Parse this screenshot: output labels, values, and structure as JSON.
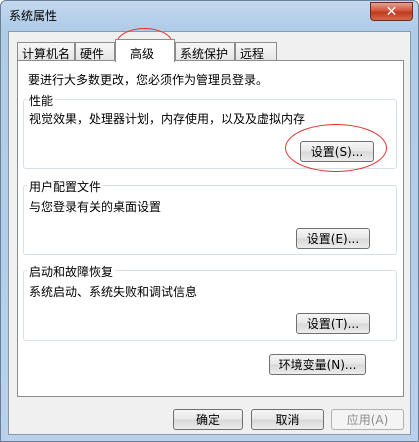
{
  "window": {
    "title": "系统属性",
    "close_symbol": "✕"
  },
  "tabs": [
    {
      "label": "计算机名",
      "active": false
    },
    {
      "label": "硬件",
      "active": false
    },
    {
      "label": "高级",
      "active": true
    },
    {
      "label": "系统保护",
      "active": false
    },
    {
      "label": "远程",
      "active": false
    }
  ],
  "advanced": {
    "intro": "要进行大多数更改，您必须作为管理员登录。",
    "performance": {
      "title": "性能",
      "description": "视觉效果，处理器计划，内存使用，以及及虚拟内存",
      "button": "设置(S)..."
    },
    "user_profiles": {
      "title": "用户配置文件",
      "description": "与您登录有关的桌面设置",
      "button": "设置(E)..."
    },
    "startup_recovery": {
      "title": "启动和故障恢复",
      "description": "系统启动、系统失败和调试信息",
      "button": "设置(T)..."
    },
    "env_button": "环境变量(N)..."
  },
  "footer": {
    "ok": "确定",
    "cancel": "取消",
    "apply": "应用(A)"
  },
  "annotation_color": "#e0332c"
}
